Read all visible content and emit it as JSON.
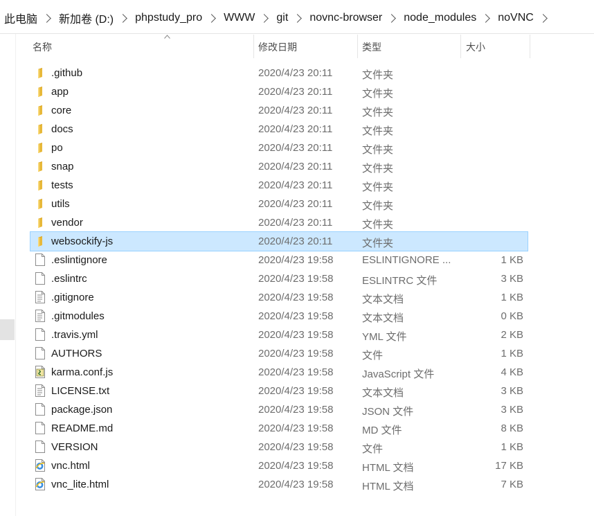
{
  "breadcrumb": [
    "此电脑",
    "新加卷 (D:)",
    "phpstudy_pro",
    "WWW",
    "git",
    "novnc-browser",
    "node_modules",
    "noVNC"
  ],
  "columns": {
    "name": "名称",
    "modified": "修改日期",
    "type": "类型",
    "size": "大小"
  },
  "colors": {
    "selection": "#cce8ff",
    "folder": "#f8d775",
    "meta_text": "#6d6d6d"
  },
  "files": [
    {
      "name": ".github",
      "date": "2020/4/23 20:11",
      "type": "文件夹",
      "size": "",
      "icon": "folder-icon"
    },
    {
      "name": "app",
      "date": "2020/4/23 20:11",
      "type": "文件夹",
      "size": "",
      "icon": "folder-icon"
    },
    {
      "name": "core",
      "date": "2020/4/23 20:11",
      "type": "文件夹",
      "size": "",
      "icon": "folder-icon"
    },
    {
      "name": "docs",
      "date": "2020/4/23 20:11",
      "type": "文件夹",
      "size": "",
      "icon": "folder-icon"
    },
    {
      "name": "po",
      "date": "2020/4/23 20:11",
      "type": "文件夹",
      "size": "",
      "icon": "folder-icon"
    },
    {
      "name": "snap",
      "date": "2020/4/23 20:11",
      "type": "文件夹",
      "size": "",
      "icon": "folder-icon"
    },
    {
      "name": "tests",
      "date": "2020/4/23 20:11",
      "type": "文件夹",
      "size": "",
      "icon": "folder-icon"
    },
    {
      "name": "utils",
      "date": "2020/4/23 20:11",
      "type": "文件夹",
      "size": "",
      "icon": "folder-icon"
    },
    {
      "name": "vendor",
      "date": "2020/4/23 20:11",
      "type": "文件夹",
      "size": "",
      "icon": "folder-icon"
    },
    {
      "name": "websockify-js",
      "date": "2020/4/23 20:11",
      "type": "文件夹",
      "size": "",
      "icon": "folder-icon",
      "selected": true
    },
    {
      "name": ".eslintignore",
      "date": "2020/4/23 19:58",
      "type": "ESLINTIGNORE ...",
      "size": "1 KB",
      "icon": "file-icon"
    },
    {
      "name": ".eslintrc",
      "date": "2020/4/23 19:58",
      "type": "ESLINTRC 文件",
      "size": "3 KB",
      "icon": "file-icon"
    },
    {
      "name": ".gitignore",
      "date": "2020/4/23 19:58",
      "type": "文本文档",
      "size": "1 KB",
      "icon": "text-file-icon"
    },
    {
      "name": ".gitmodules",
      "date": "2020/4/23 19:58",
      "type": "文本文档",
      "size": "0 KB",
      "icon": "text-file-icon"
    },
    {
      "name": ".travis.yml",
      "date": "2020/4/23 19:58",
      "type": "YML 文件",
      "size": "2 KB",
      "icon": "file-icon"
    },
    {
      "name": "AUTHORS",
      "date": "2020/4/23 19:58",
      "type": "文件",
      "size": "1 KB",
      "icon": "file-icon"
    },
    {
      "name": "karma.conf.js",
      "date": "2020/4/23 19:58",
      "type": "JavaScript 文件",
      "size": "4 KB",
      "icon": "js-file-icon"
    },
    {
      "name": "LICENSE.txt",
      "date": "2020/4/23 19:58",
      "type": "文本文档",
      "size": "3 KB",
      "icon": "text-file-icon"
    },
    {
      "name": "package.json",
      "date": "2020/4/23 19:58",
      "type": "JSON 文件",
      "size": "3 KB",
      "icon": "file-icon"
    },
    {
      "name": "README.md",
      "date": "2020/4/23 19:58",
      "type": "MD 文件",
      "size": "8 KB",
      "icon": "file-icon"
    },
    {
      "name": "VERSION",
      "date": "2020/4/23 19:58",
      "type": "文件",
      "size": "1 KB",
      "icon": "file-icon"
    },
    {
      "name": "vnc.html",
      "date": "2020/4/23 19:58",
      "type": "HTML 文档",
      "size": "17 KB",
      "icon": "html-file-icon"
    },
    {
      "name": "vnc_lite.html",
      "date": "2020/4/23 19:58",
      "type": "HTML 文档",
      "size": "7 KB",
      "icon": "html-file-icon"
    }
  ]
}
